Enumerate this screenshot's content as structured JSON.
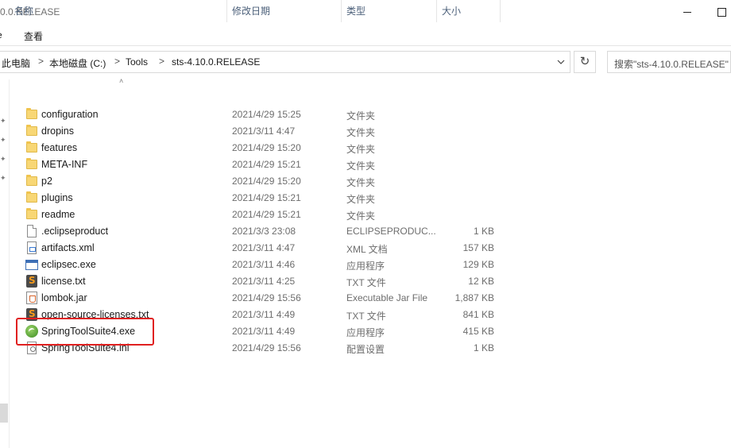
{
  "window": {
    "title": "0.0.RELEASE"
  },
  "ribbon": {
    "tab_left": "e",
    "tab_view": "查看"
  },
  "address": {
    "crumbs": [
      "此电脑",
      "本地磁盘 (C:)",
      "Tools",
      "sts-4.10.0.RELEASE"
    ],
    "separator": ">"
  },
  "search": {
    "placeholder": "搜索\"sts-4.10.0.RELEASE\""
  },
  "columns": {
    "name": "名称",
    "date": "修改日期",
    "type": "类型",
    "size": "大小"
  },
  "files": [
    {
      "name": "configuration",
      "date": "2021/4/29 15:25",
      "type": "文件夹",
      "size": "",
      "icon": "folder-icon"
    },
    {
      "name": "dropins",
      "date": "2021/3/11 4:47",
      "type": "文件夹",
      "size": "",
      "icon": "folder-icon"
    },
    {
      "name": "features",
      "date": "2021/4/29 15:20",
      "type": "文件夹",
      "size": "",
      "icon": "folder-icon"
    },
    {
      "name": "META-INF",
      "date": "2021/4/29 15:21",
      "type": "文件夹",
      "size": "",
      "icon": "folder-icon"
    },
    {
      "name": "p2",
      "date": "2021/4/29 15:20",
      "type": "文件夹",
      "size": "",
      "icon": "folder-icon"
    },
    {
      "name": "plugins",
      "date": "2021/4/29 15:21",
      "type": "文件夹",
      "size": "",
      "icon": "folder-icon"
    },
    {
      "name": "readme",
      "date": "2021/4/29 15:21",
      "type": "文件夹",
      "size": "",
      "icon": "folder-icon"
    },
    {
      "name": ".eclipseproduct",
      "date": "2021/3/3 23:08",
      "type": "ECLIPSEPRODUC...",
      "size": "1 KB",
      "icon": "document-icon"
    },
    {
      "name": "artifacts.xml",
      "date": "2021/3/11 4:47",
      "type": "XML 文档",
      "size": "157 KB",
      "icon": "xml-file-icon"
    },
    {
      "name": "eclipsec.exe",
      "date": "2021/3/11 4:46",
      "type": "应用程序",
      "size": "129 KB",
      "icon": "application-icon"
    },
    {
      "name": "license.txt",
      "date": "2021/3/11 4:25",
      "type": "TXT 文件",
      "size": "12 KB",
      "icon": "sublime-text-icon"
    },
    {
      "name": "lombok.jar",
      "date": "2021/4/29 15:56",
      "type": "Executable Jar File",
      "size": "1,887 KB",
      "icon": "java-jar-icon"
    },
    {
      "name": "open-source-licenses.txt",
      "date": "2021/3/11 4:49",
      "type": "TXT 文件",
      "size": "841 KB",
      "icon": "sublime-text-icon"
    },
    {
      "name": "SpringToolSuite4.exe",
      "date": "2021/3/11 4:49",
      "type": "应用程序",
      "size": "415 KB",
      "icon": "spring-leaf-icon"
    },
    {
      "name": "SpringToolSuite4.ini",
      "date": "2021/4/29 15:56",
      "type": "配置设置",
      "size": "1 KB",
      "icon": "settings-file-icon"
    }
  ],
  "highlight_color": "#e02020"
}
